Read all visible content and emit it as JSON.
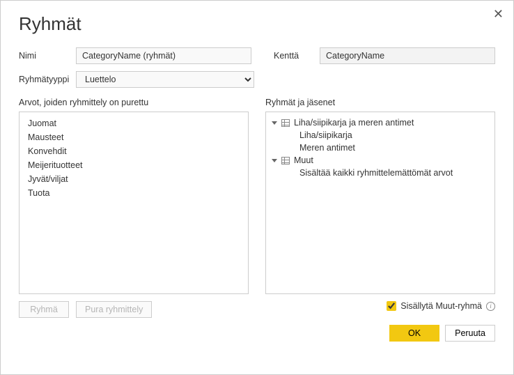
{
  "dialog": {
    "title": "Ryhmät",
    "close": "✕"
  },
  "form": {
    "name_label": "Nimi",
    "name_value": "CategoryName (ryhmät)",
    "field_label": "Kenttä",
    "field_value": "CategoryName",
    "type_label": "Ryhmätyyppi",
    "type_value": "Luettelo"
  },
  "left": {
    "title": "Arvot, joiden ryhmittely on purettu",
    "items": [
      "Juomat",
      "Mausteet",
      "Konvehdit",
      "Meijerituotteet",
      "Jyvät/viljat",
      "Tuota"
    ]
  },
  "right": {
    "title": "Ryhmät ja jäsenet",
    "groups": [
      {
        "label": "Liha/siipikarja ja meren antimet",
        "children": [
          "Liha/siipikarja",
          "Meren antimet"
        ]
      },
      {
        "label": "Muut",
        "children": [
          "Sisältää kaikki ryhmittelemättömät arvot"
        ]
      }
    ]
  },
  "buttons": {
    "group": "Ryhmä",
    "ungroup": "Pura ryhmittely",
    "include_other": "Sisällytä Muut-ryhmä",
    "ok": "OK",
    "cancel": "Peruuta"
  }
}
